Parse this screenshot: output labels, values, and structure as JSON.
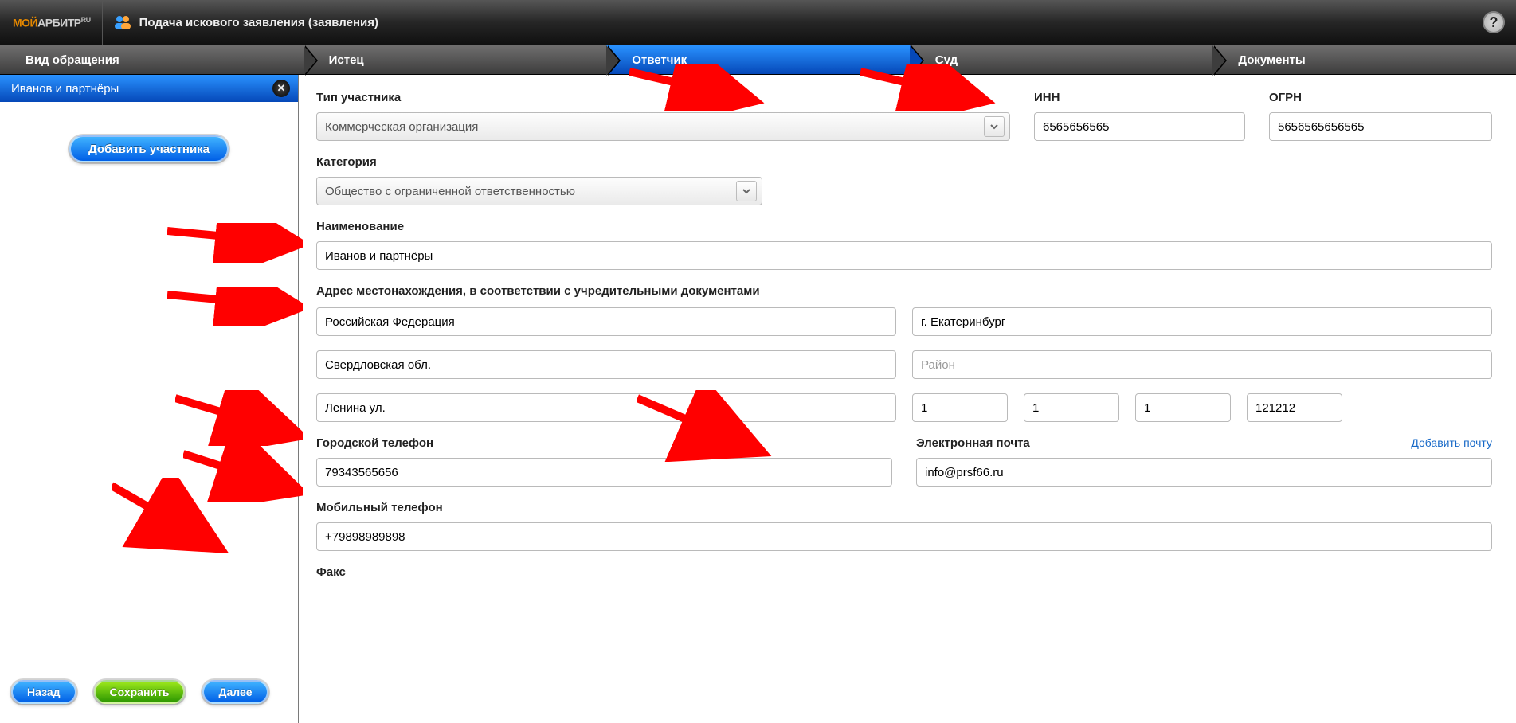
{
  "header": {
    "logo_left": "МОЙ",
    "logo_right": "АРБИТР",
    "logo_sup": "RU",
    "title": "Подача искового заявления (заявления)"
  },
  "steps": {
    "s1": "Вид обращения",
    "s2": "Истец",
    "s3": "Ответчик",
    "s4": "Суд",
    "s5": "Документы"
  },
  "sidebar": {
    "participant": "Иванов и партнёры",
    "add_participant": "Добавить участника",
    "back": "Назад",
    "save": "Сохранить",
    "next": "Далее"
  },
  "form": {
    "type_label": "Тип участника",
    "type_value": "Коммерческая организация",
    "inn_label": "ИНН",
    "inn_value": "6565656565",
    "ogrn_label": "ОГРН",
    "ogrn_value": "5656565656565",
    "category_label": "Категория",
    "category_value": "Общество с ограниченной ответственностью",
    "name_label": "Наименование",
    "name_value": "Иванов и партнёры",
    "address_label": "Адрес местонахождения, в соответствии с учредительными документами",
    "country": "Российская Федерация",
    "city": "г. Екатеринбург",
    "region": "Свердловская обл.",
    "district_placeholder": "Район",
    "street": "Ленина ул.",
    "house": "1",
    "building": "1",
    "flat": "1",
    "postcode": "121212",
    "phone_city_label": "Городской телефон",
    "phone_city_value": "79343565656",
    "email_label": "Электронная почта",
    "email_add": "Добавить почту",
    "email_value": "info@prsf66.ru",
    "phone_mobile_label": "Мобильный телефон",
    "phone_mobile_value": "+79898989898",
    "fax_label": "Факс"
  }
}
